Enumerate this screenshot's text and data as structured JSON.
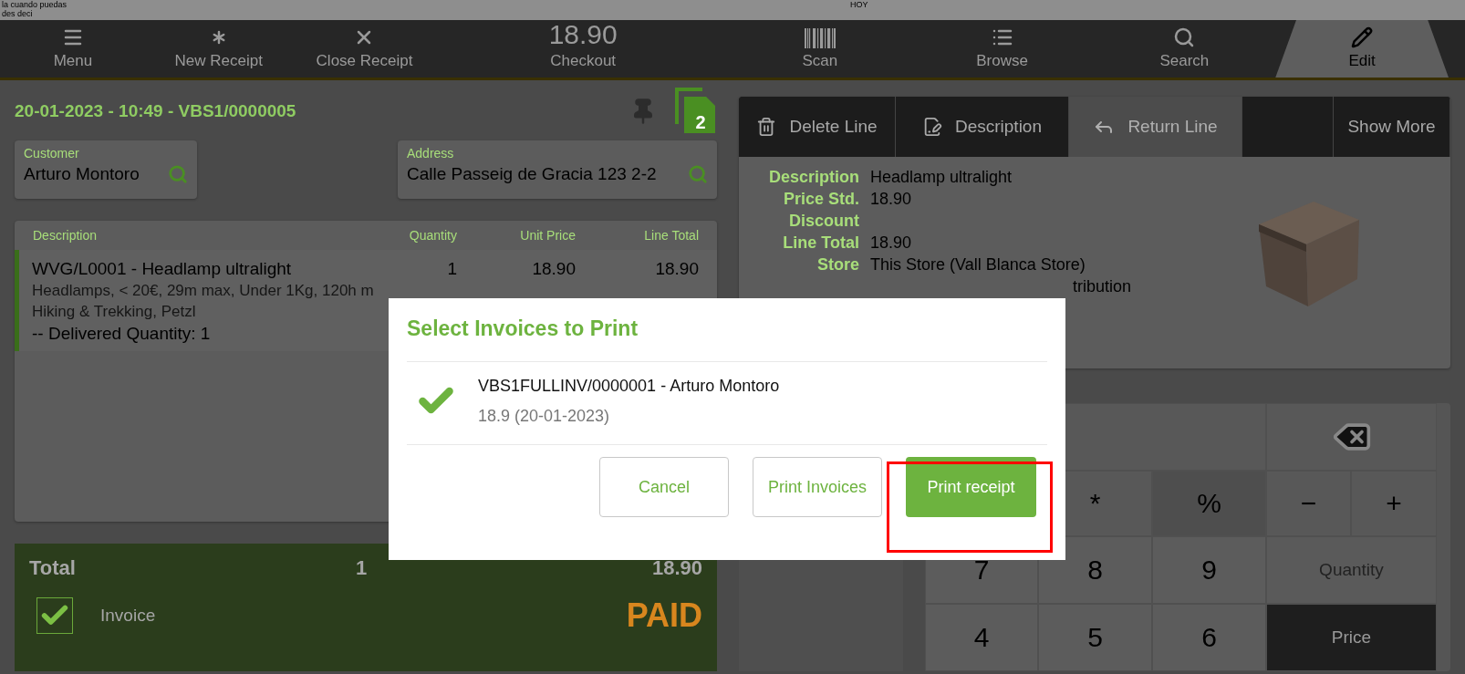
{
  "top_strip": {
    "texts": [
      "la cuando puedas",
      "des deci"
    ],
    "right_text": "HOY"
  },
  "toolbar": {
    "items": [
      {
        "label": "Menu",
        "kind": "menu",
        "selected": false
      },
      {
        "label": "New Receipt",
        "kind": "new",
        "selected": false
      },
      {
        "label": "Close Receipt",
        "kind": "close",
        "selected": false
      },
      {
        "label": "Checkout",
        "kind": "checkout",
        "amount": "18.90",
        "selected": false
      },
      {
        "label": "Scan",
        "kind": "scan",
        "selected": false
      },
      {
        "label": "Browse",
        "kind": "browse",
        "selected": false
      },
      {
        "label": "Search",
        "kind": "search",
        "selected": false
      },
      {
        "label": "Edit",
        "kind": "edit",
        "selected": true
      }
    ]
  },
  "receipt": {
    "title": "20-01-2023 - 10:49 - VBS1/0000005",
    "counter": "2",
    "customer": {
      "label": "Customer",
      "value": "Arturo Montoro"
    },
    "address": {
      "label": "Address",
      "value": "Calle Passeig de Gracia 123 2-2"
    },
    "table": {
      "columns": [
        "Description",
        "Quantity",
        "Unit Price",
        "Line Total"
      ],
      "rows": [
        {
          "description": "WVG/L0001 - Headlamp ultralight",
          "quantity": "1",
          "unit_price": "18.90",
          "line_total": "18.90",
          "details": [
            "Headlamps, < 20€, 29m max, Under 1Kg, 120h m",
            "Hiking & Trekking, Petzl"
          ],
          "note": "-- Delivered Quantity: 1",
          "selected": true
        }
      ]
    },
    "total": {
      "label": "Total",
      "quantity": "1",
      "amount": "18.90",
      "invoice": {
        "label": "Invoice",
        "checked": true
      },
      "status": "PAID"
    }
  },
  "line_panel": {
    "actions": [
      {
        "label": "Delete Line",
        "kind": "delete",
        "disabled": false
      },
      {
        "label": "Description",
        "kind": "description",
        "disabled": false
      },
      {
        "label": "Return Line",
        "kind": "return",
        "disabled": true
      },
      {
        "kind": "blank"
      },
      {
        "label": "Show More",
        "kind": "more",
        "disabled": false
      }
    ],
    "details": [
      {
        "label": "Description",
        "value": "Headlamp ultralight"
      },
      {
        "label": "Price Std.",
        "value": "18.90"
      },
      {
        "label": "Discount"
      },
      {
        "label": "Line Total",
        "value": "18.90"
      },
      {
        "label": "Store",
        "value": "This Store (Vall Blanca Store)"
      },
      {
        "value": "tribution",
        "kind": "covered"
      }
    ]
  },
  "keypad": {
    "keys": [
      {
        "kind": "display"
      },
      {
        "kind": "backspace"
      },
      {
        "kind": "blank"
      },
      {
        "kind": "op",
        "label": "*"
      },
      {
        "kind": "op-dark",
        "label": "%"
      },
      {
        "kind": "op",
        "label": "−"
      },
      {
        "kind": "op",
        "label": "+"
      },
      {
        "kind": "digit",
        "label": "7"
      },
      {
        "kind": "digit",
        "label": "8"
      },
      {
        "kind": "digit",
        "label": "9"
      },
      {
        "kind": "mode",
        "label": "Quantity",
        "selected": false
      },
      {
        "kind": "digit",
        "label": "4"
      },
      {
        "kind": "digit",
        "label": "5"
      },
      {
        "kind": "digit",
        "label": "6"
      },
      {
        "kind": "mode",
        "label": "Price",
        "selected": true
      }
    ]
  },
  "dialog": {
    "title": "Select Invoices to Print",
    "items": [
      {
        "title": "VBS1FULLINV/0000001 - Arturo Montoro",
        "subtitle": "18.9 (20-01-2023)",
        "selected": true
      }
    ],
    "buttons": [
      {
        "label": "Cancel",
        "kind": "secondary"
      },
      {
        "label": "Print Invoices",
        "kind": "secondary"
      },
      {
        "label": "Print receipt",
        "kind": "primary"
      }
    ]
  }
}
